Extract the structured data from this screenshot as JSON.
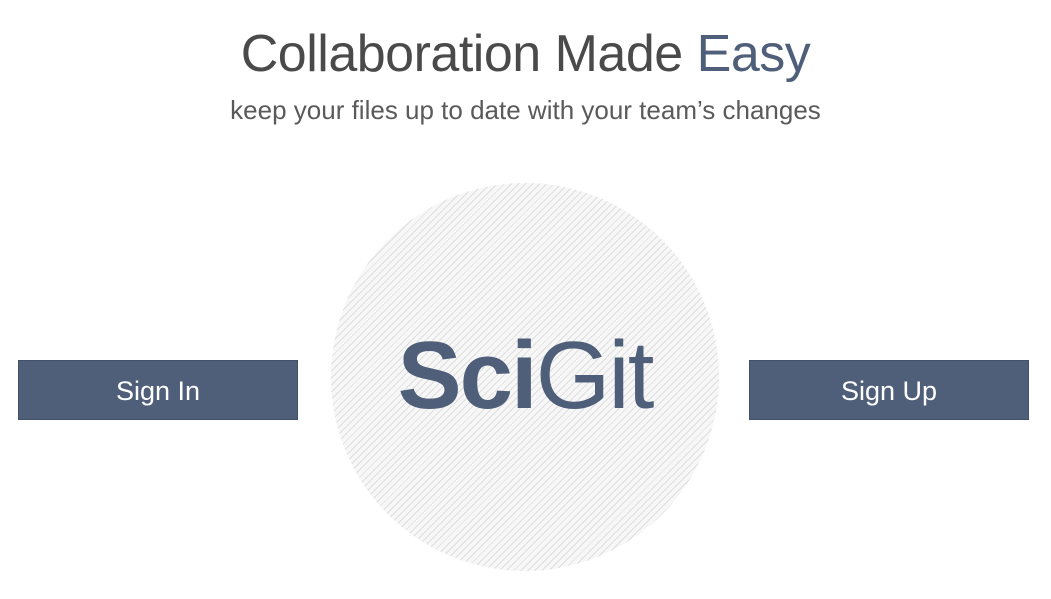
{
  "hero": {
    "headline_main": "Collaboration Made ",
    "headline_accent": "Easy",
    "subtitle": "keep your files up to date with your team’s changes"
  },
  "logo": {
    "part_bold": "Sci",
    "part_light": "Git"
  },
  "actions": {
    "sign_in_label": "Sign In",
    "sign_up_label": "Sign Up"
  },
  "colors": {
    "accent": "#4f5f7a",
    "text_dark": "#4a4a4a",
    "text_muted": "#5a5a5a",
    "button_text": "#ffffff"
  }
}
